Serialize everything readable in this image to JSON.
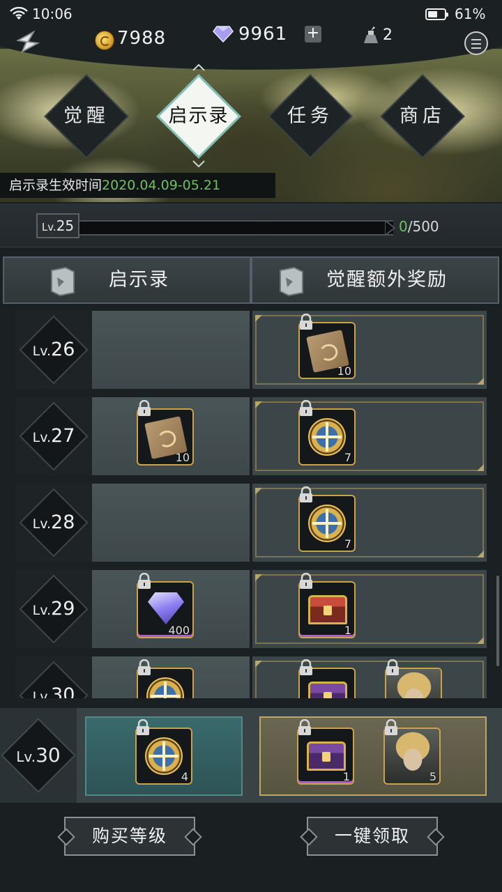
{
  "status_bar": {
    "time": "10:06",
    "battery_text": "61%",
    "battery_level": 0.61
  },
  "currencies": {
    "coins": "7988",
    "diamonds": "9961",
    "potions": "2"
  },
  "nav_tabs": [
    {
      "label": "觉醒",
      "active": false
    },
    {
      "label": "启示录",
      "active": true
    },
    {
      "label": "任务",
      "active": false
    },
    {
      "label": "商店",
      "active": false
    }
  ],
  "period": {
    "label": "启示录生效时间",
    "dates": "2020.04.09-05.21"
  },
  "level_bar": {
    "level_prefix": "Lv.",
    "level": "25",
    "progress_current": "0",
    "progress_total": "/500",
    "progress_fraction": 0.0
  },
  "columns": {
    "free": "启示录",
    "premium": "觉醒额外奖励"
  },
  "rows": [
    {
      "lv_prefix": "Lv.",
      "lv": "26",
      "free": [],
      "premium": [
        {
          "icon": "scroll-icon",
          "qty": "10"
        }
      ]
    },
    {
      "lv_prefix": "Lv.",
      "lv": "27",
      "free": [
        {
          "icon": "scroll-icon",
          "qty": "10"
        }
      ],
      "premium": [
        {
          "icon": "compass-emblem-icon",
          "qty": "7"
        }
      ]
    },
    {
      "lv_prefix": "Lv.",
      "lv": "28",
      "free": [],
      "premium": [
        {
          "icon": "compass-emblem-icon",
          "qty": "7"
        }
      ]
    },
    {
      "lv_prefix": "Lv.",
      "lv": "29",
      "free": [
        {
          "icon": "diamond-gem-icon",
          "qty": "400"
        }
      ],
      "premium": [
        {
          "icon": "red-treasure-chest-icon",
          "qty": "1"
        }
      ]
    },
    {
      "lv_prefix": "Lv.",
      "lv": "30",
      "free": [
        {
          "icon": "compass-emblem-icon",
          "qty": ""
        }
      ],
      "premium": [
        {
          "icon": "gold-treasure-chest-icon",
          "qty": ""
        },
        {
          "icon": "hero-portrait-icon",
          "qty": ""
        }
      ]
    }
  ],
  "current_row": {
    "lv_prefix": "Lv.",
    "lv": "30",
    "free": [
      {
        "icon": "compass-emblem-icon",
        "qty": "4"
      }
    ],
    "premium": [
      {
        "icon": "gold-treasure-chest-icon",
        "qty": "1"
      },
      {
        "icon": "hero-portrait-icon",
        "qty": "5"
      }
    ]
  },
  "buttons": {
    "buy_level": "购买等级",
    "claim_all": "一键领取"
  }
}
